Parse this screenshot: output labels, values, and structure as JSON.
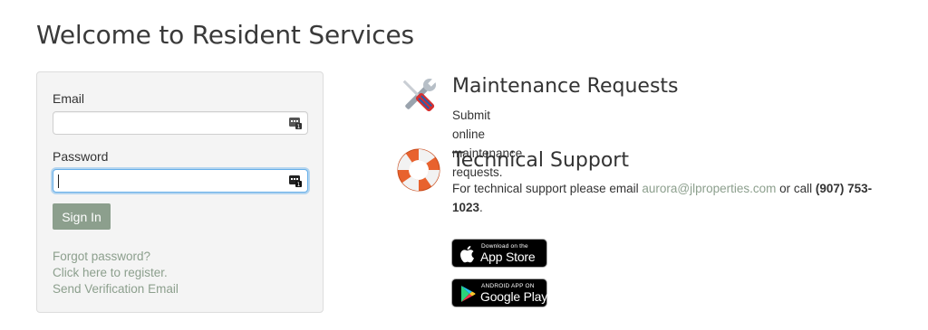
{
  "page": {
    "title": "Welcome to Resident Services"
  },
  "login": {
    "email_label": "Email",
    "email_value": "",
    "password_label": "Password",
    "password_value": "",
    "signin_label": "Sign In",
    "links": {
      "forgot": "Forgot password?",
      "register": "Click here to register.",
      "verify": "Send Verification Email"
    }
  },
  "services": {
    "maintenance": {
      "icon": "tools-icon",
      "title": "Maintenance Requests",
      "description": "Submit online maintenance requests."
    },
    "support": {
      "icon": "lifebuoy-icon",
      "title": "Technical Support",
      "description_prefix": "For technical support please email ",
      "email": "aurora@jlproperties.com",
      "description_middle": " or call ",
      "phone": "(907) 753-1023",
      "description_suffix": "."
    }
  },
  "badges": {
    "app_store": {
      "small": "Download on the",
      "big": "App Store",
      "icon": "apple-icon"
    },
    "google_play": {
      "small": "ANDROID APP ON",
      "big": "Google Play",
      "icon": "play-icon"
    }
  },
  "colors": {
    "accent": "#8c9f8d",
    "focus": "#66afe9",
    "card_bg": "#f4f4f4",
    "badge_bg": "#000000"
  }
}
